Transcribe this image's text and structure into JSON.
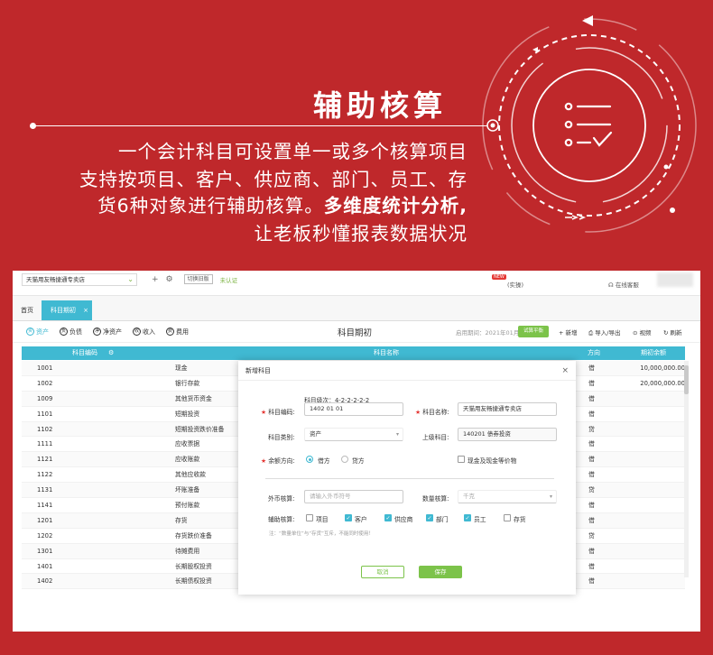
{
  "hero": {
    "title": "辅助核算",
    "line1": "一个会计科目可设置单一或多个核算项目",
    "line2": "支持按项目、客户、供应商、部门、员工、存",
    "line3_normal": "货6种对象进行辅助核算。",
    "line3_bold": "多维度统计分析,",
    "line4": "让老板秒懂报表数据状况"
  },
  "topbar": {
    "org_name": "天猫用友畅捷通专卖店",
    "switch_label": "切换旧版",
    "certified": "未认证",
    "new_badge": "NEW",
    "user": "(实操)",
    "service": "在线客服"
  },
  "tabs": {
    "home": "首页",
    "active": "科目期初",
    "close": "×"
  },
  "toolbar": {
    "categories": [
      "资产",
      "负债",
      "净资产",
      "收入",
      "费用"
    ],
    "category_icons": [
      "资",
      "负",
      "净",
      "收",
      "费"
    ],
    "title": "科目期初",
    "period": "启用期间：2021年01月",
    "trial_balance": "试算平衡",
    "add": "+ 新增",
    "import_export": "导入/导出",
    "video": "视频",
    "refresh": "刷新"
  },
  "table": {
    "headers": [
      "科目编码",
      "科目名称",
      "方向",
      "期初余额"
    ],
    "rows": [
      {
        "code": "1001",
        "name": "现金",
        "dir": "借",
        "amount": "10,000,000.00"
      },
      {
        "code": "1002",
        "name": "银行存款",
        "dir": "借",
        "amount": "20,000,000.00"
      },
      {
        "code": "1009",
        "name": "其他货币资金",
        "dir": "借",
        "amount": ""
      },
      {
        "code": "1101",
        "name": "短期投资",
        "dir": "借",
        "amount": ""
      },
      {
        "code": "1102",
        "name": "短期投资跌价准备",
        "dir": "贷",
        "amount": ""
      },
      {
        "code": "1111",
        "name": "应收票据",
        "dir": "借",
        "amount": ""
      },
      {
        "code": "1121",
        "name": "应收账款",
        "dir": "借",
        "amount": ""
      },
      {
        "code": "1122",
        "name": "其他应收款",
        "dir": "借",
        "amount": ""
      },
      {
        "code": "1131",
        "name": "坏账准备",
        "dir": "贷",
        "amount": ""
      },
      {
        "code": "1141",
        "name": "预付账款",
        "dir": "借",
        "amount": ""
      },
      {
        "code": "1201",
        "name": "存货",
        "dir": "借",
        "amount": ""
      },
      {
        "code": "1202",
        "name": "存货跌价准备",
        "dir": "贷",
        "amount": ""
      },
      {
        "code": "1301",
        "name": "待摊费用",
        "dir": "借",
        "amount": ""
      },
      {
        "code": "1401",
        "name": "长期股权投资",
        "dir": "借",
        "amount": ""
      },
      {
        "code": "1402",
        "name": "长期债权投资",
        "dir": "借",
        "amount": ""
      }
    ]
  },
  "modal": {
    "title": "新增科目",
    "level_label": "科目级次：",
    "level_value": "4-2-2-2-2-2",
    "code_label": "科目编码:",
    "code_value": "1402 01 01",
    "name_label": "科目名称:",
    "name_value": "天猫用友畅捷通专卖店",
    "type_label": "科目类别:",
    "type_value": "资产",
    "parent_label": "上级科目:",
    "parent_value": "140201 债券投资",
    "direction_label": "余额方向:",
    "debit": "借方",
    "credit": "贷方",
    "cash_equiv": "现金及现金等价物",
    "foreign_label": "外币核算:",
    "foreign_placeholder": "请输入外币符号",
    "qty_label": "数量核算:",
    "qty_value": "千克",
    "aux_label": "辅助核算:",
    "aux_items": [
      {
        "label": "项目",
        "checked": false
      },
      {
        "label": "客户",
        "checked": true
      },
      {
        "label": "供应商",
        "checked": true
      },
      {
        "label": "部门",
        "checked": true
      },
      {
        "label": "员工",
        "checked": true
      },
      {
        "label": "存货",
        "checked": false
      }
    ],
    "note": "注：“数量单位”与“存货”互斥，不能同时使用！",
    "cancel": "取消",
    "save": "保存"
  },
  "colors": {
    "background": "#bf282b",
    "accent": "#40b9d2",
    "green": "#7cc34a"
  }
}
